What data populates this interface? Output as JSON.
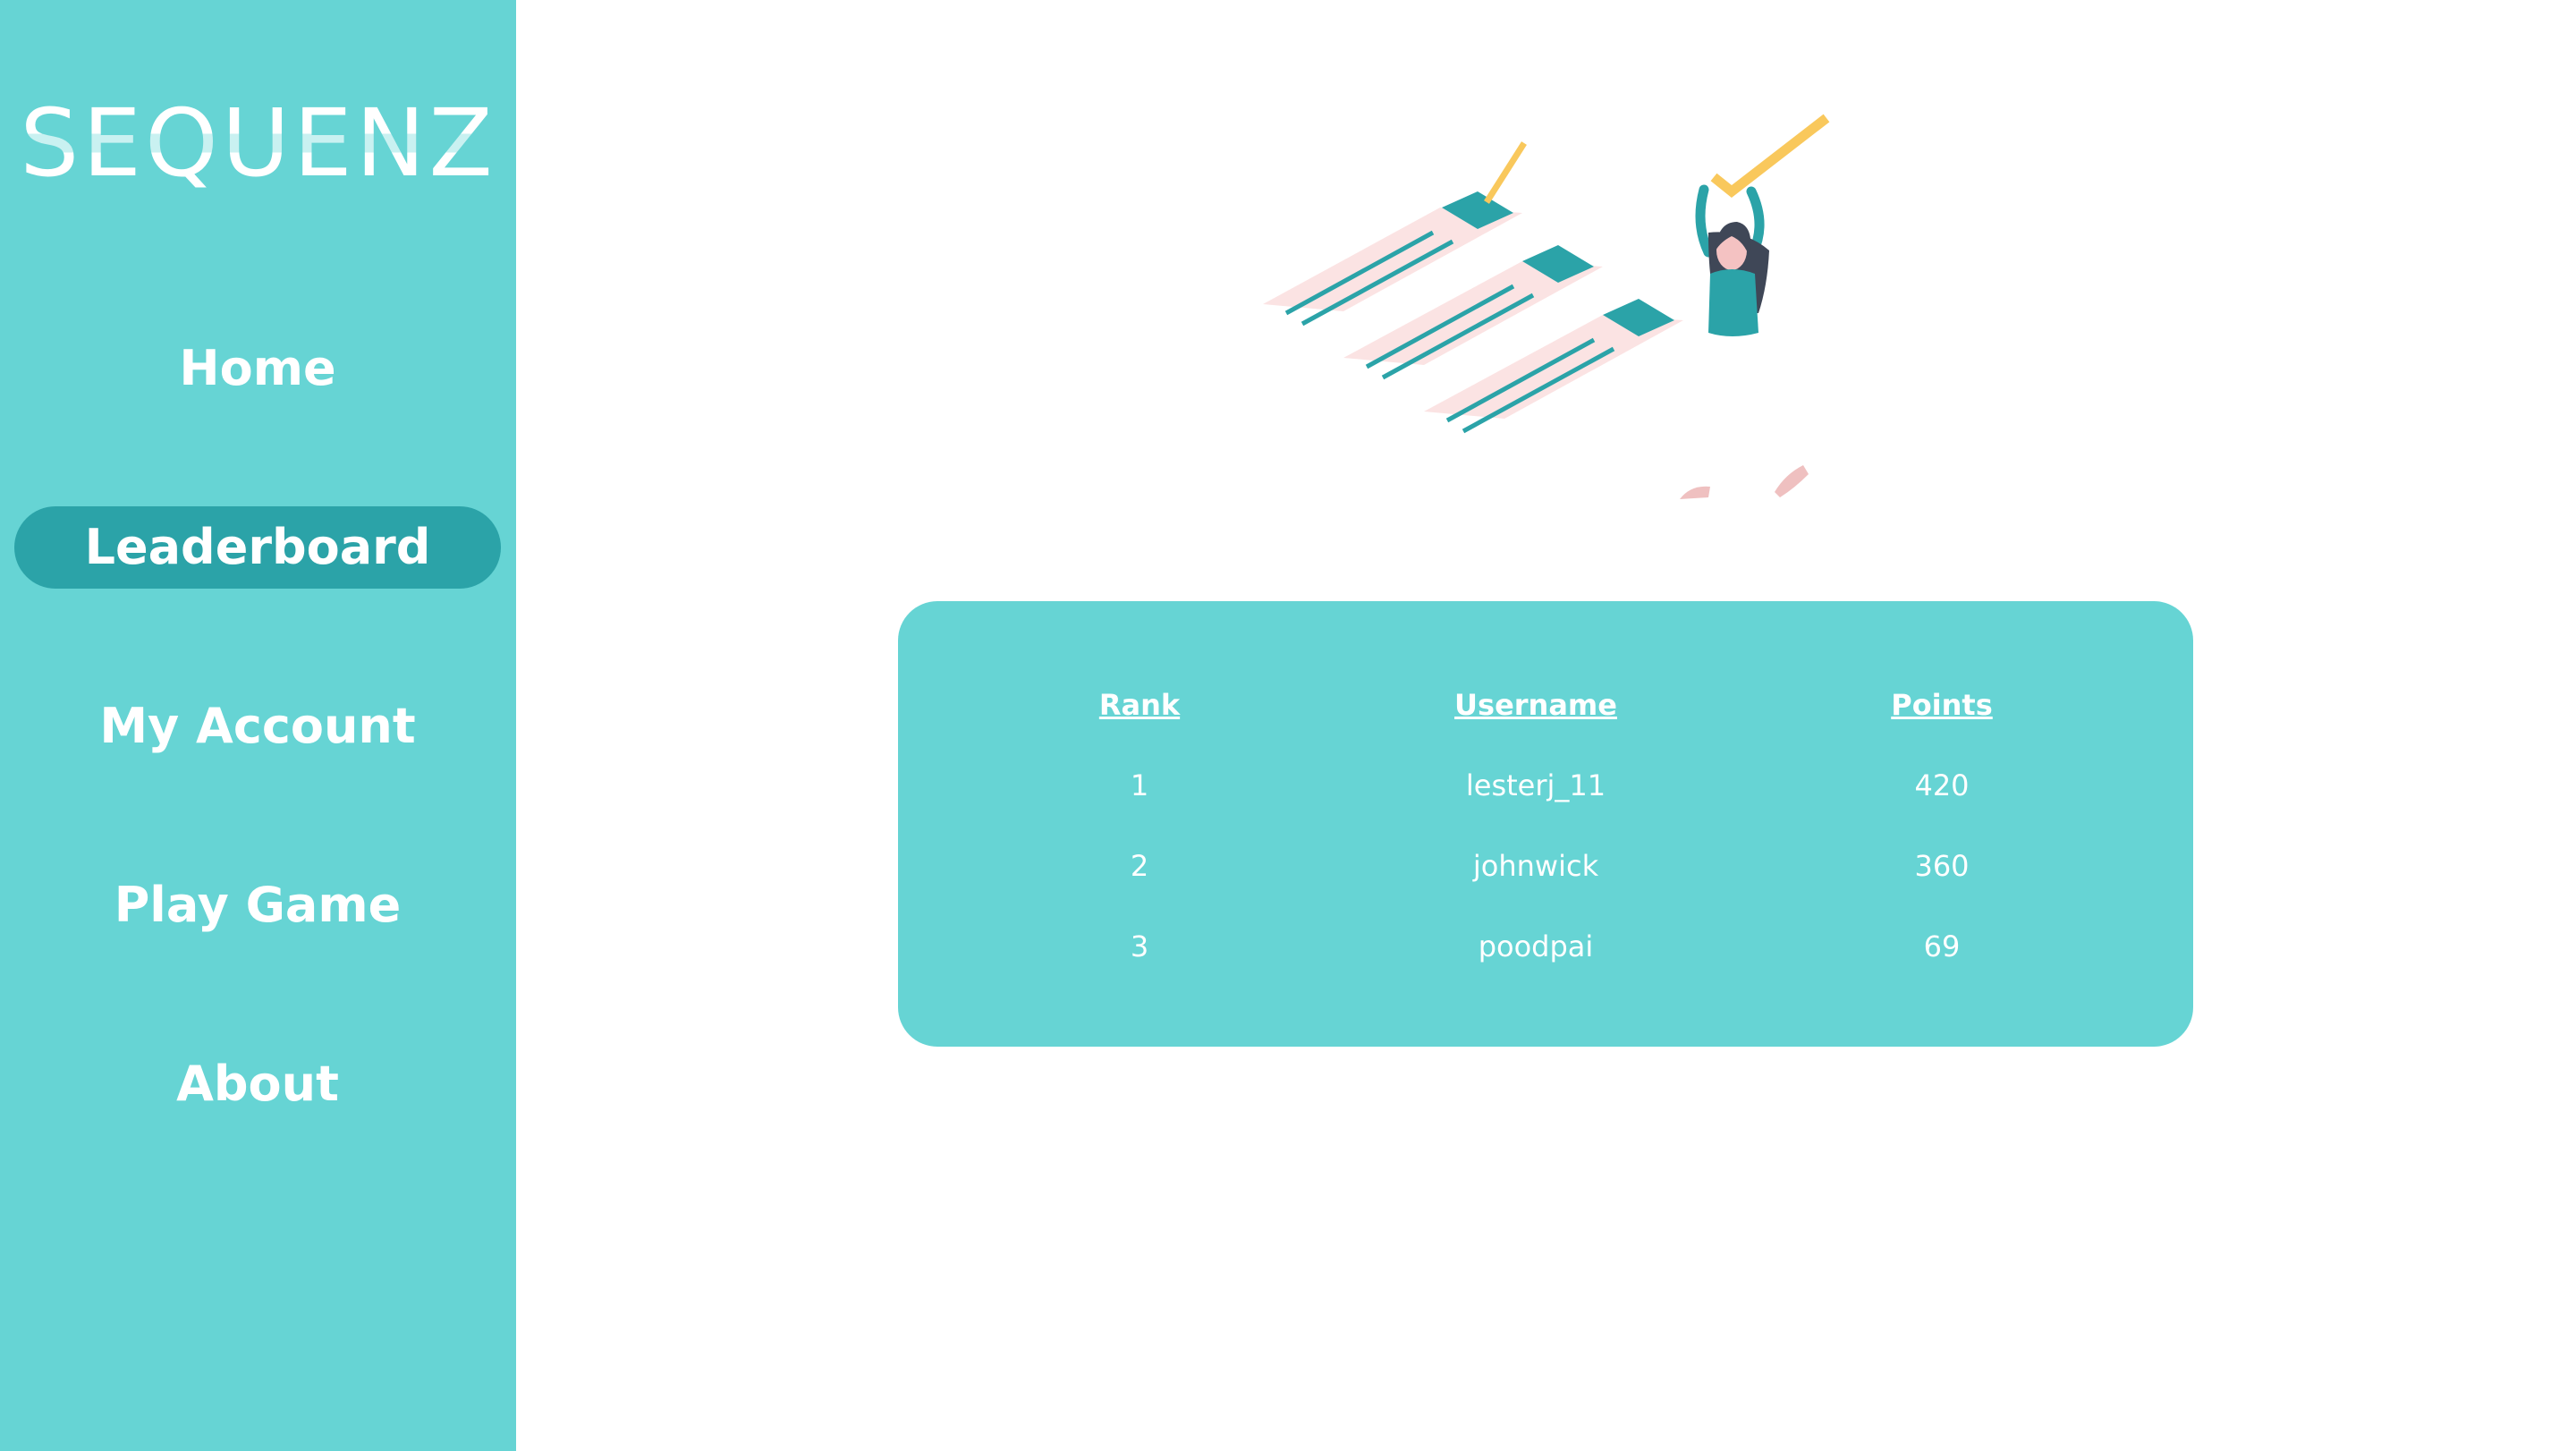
{
  "app": {
    "logo": "SEQUENZ"
  },
  "sidebar": {
    "items": [
      {
        "label": "Home"
      },
      {
        "label": "Leaderboard"
      },
      {
        "label": "My Account"
      },
      {
        "label": "Play Game"
      },
      {
        "label": "About"
      }
    ],
    "active_item": "Leaderboard"
  },
  "leaderboard": {
    "columns": [
      "Rank",
      "Username",
      "Points"
    ],
    "rows": [
      {
        "rank": "1",
        "username": "lesterj_11",
        "points": "420"
      },
      {
        "rank": "2",
        "username": "johnwick",
        "points": "360"
      },
      {
        "rank": "3",
        "username": "poodpai",
        "points": "69"
      }
    ]
  },
  "illustration": {
    "icon": "checklist-woman-illustration"
  },
  "colors": {
    "accent": "#66d4d4",
    "accent_dark": "#2ba3a8",
    "text_light": "#ffffff",
    "check_yellow": "#f9c85c",
    "paper_pink": "#fbe3e3"
  }
}
